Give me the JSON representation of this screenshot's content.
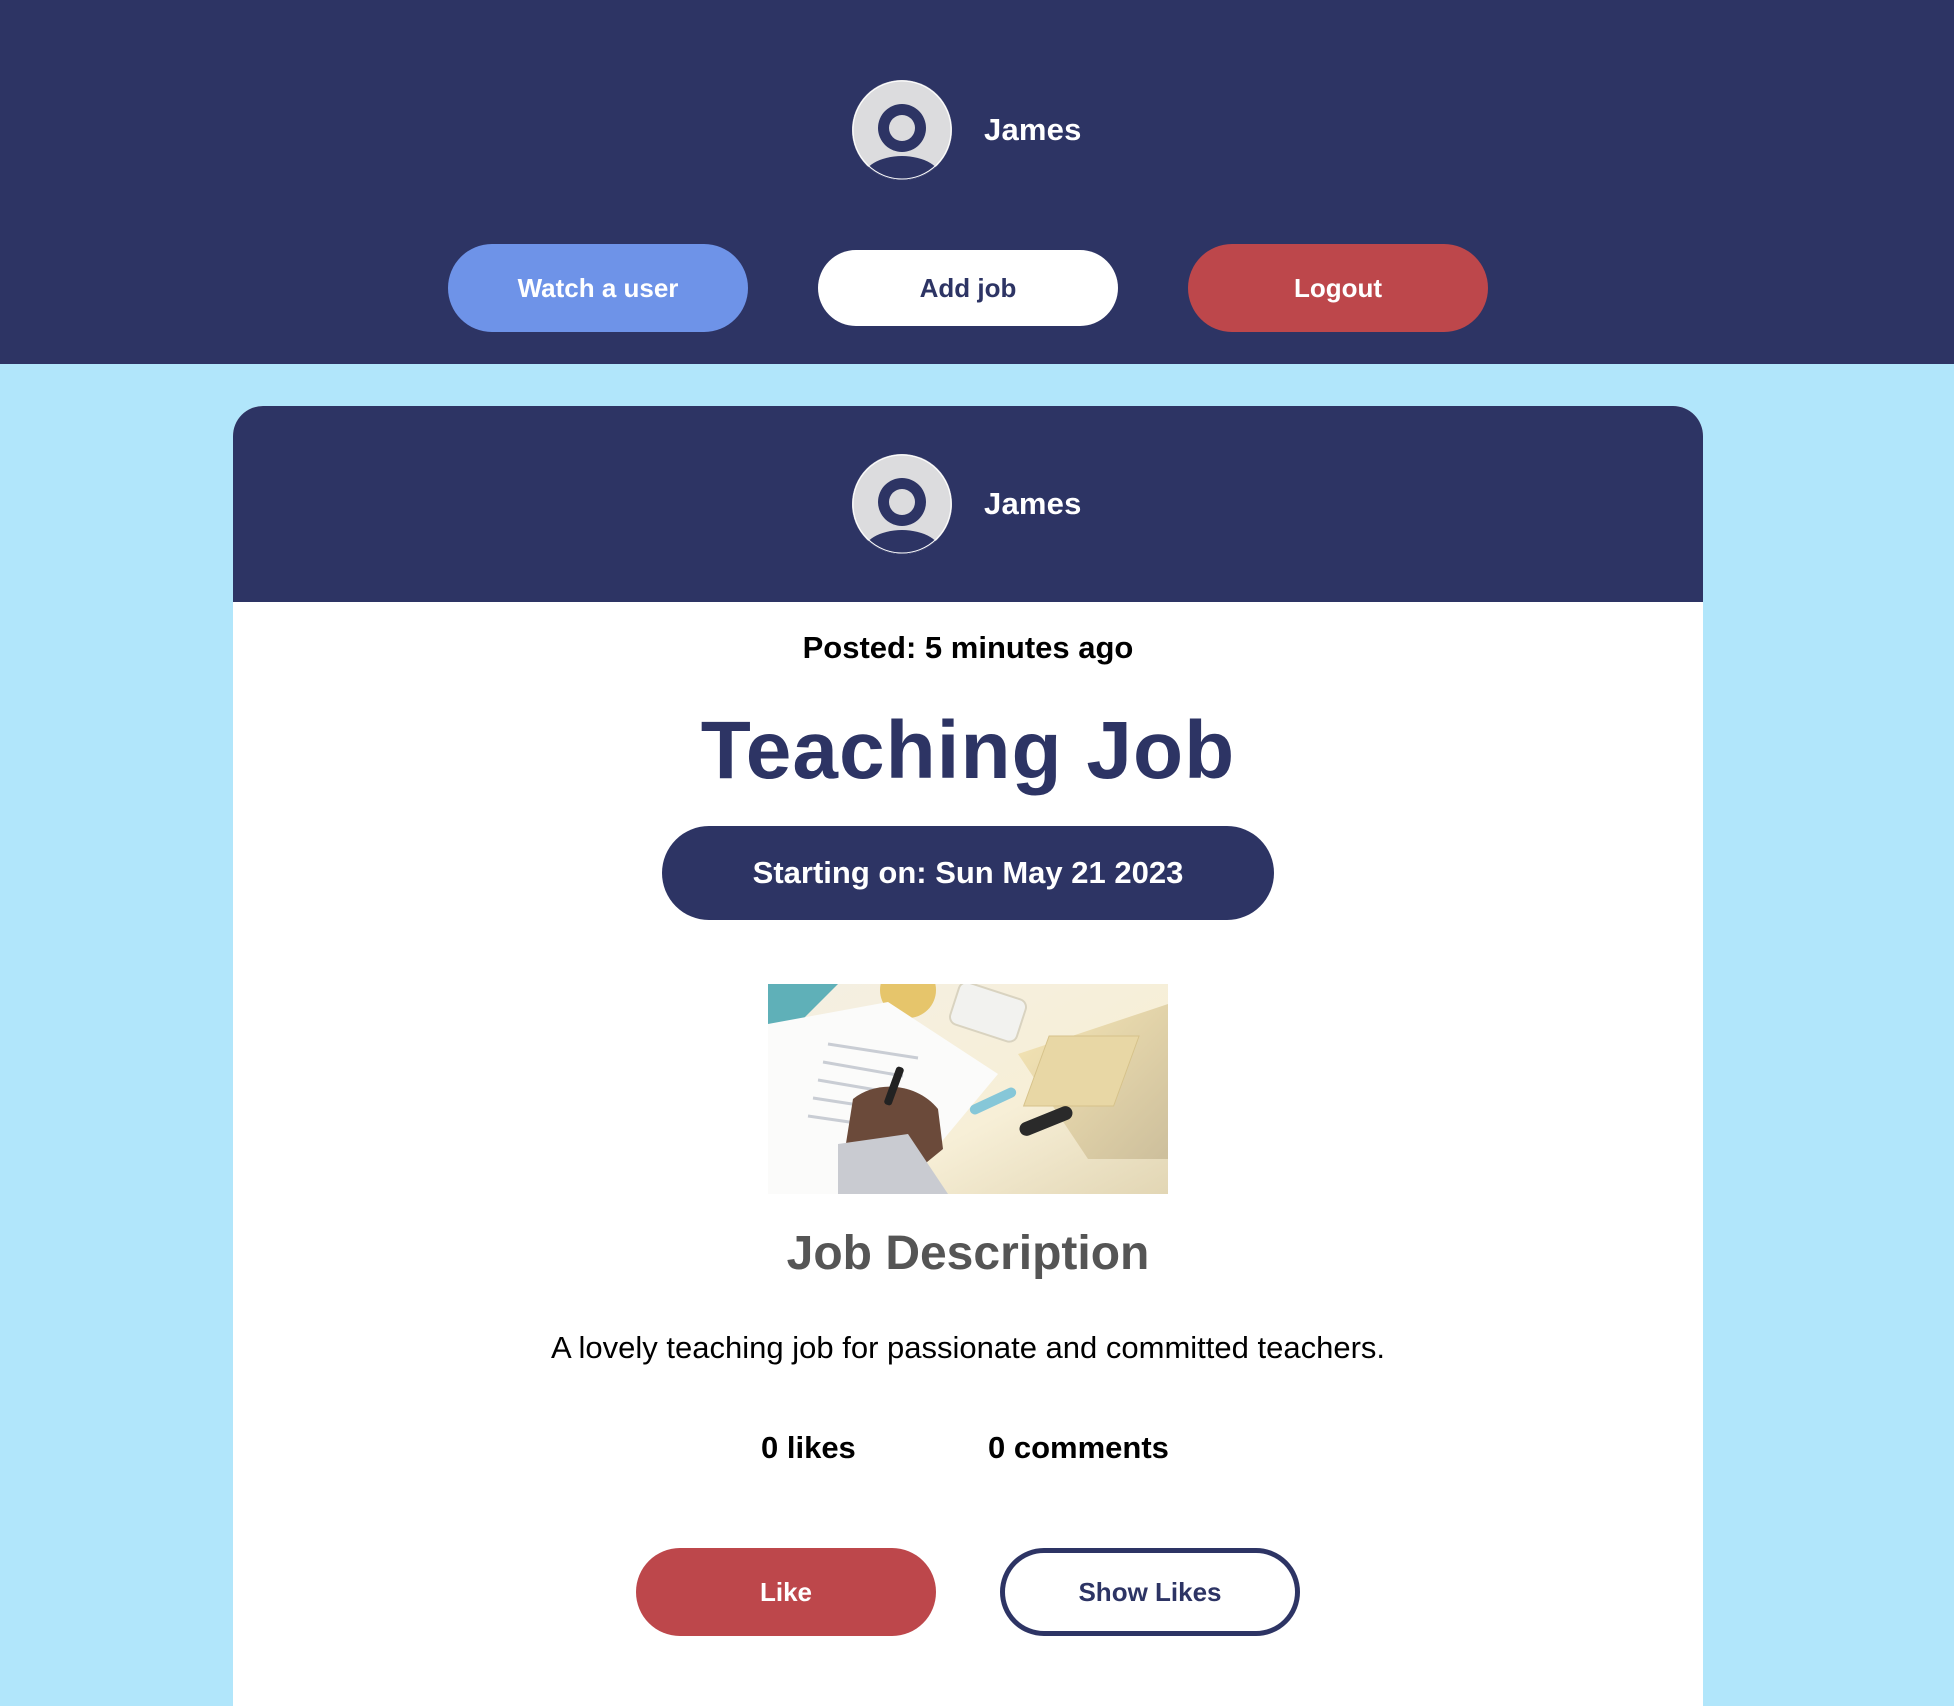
{
  "header": {
    "user": {
      "name": "James",
      "avatar_icon": "user-avatar-icon"
    },
    "buttons": {
      "watch_user": "Watch a user",
      "add_job": "Add job",
      "logout": "Logout"
    }
  },
  "post": {
    "author": {
      "name": "James",
      "avatar_icon": "user-avatar-icon"
    },
    "posted": "Posted: 5 minutes ago",
    "title": "Teaching Job",
    "start_date": "Starting on: Sun May 21 2023",
    "image_subject": "job-description-photo",
    "description_heading": "Job Description",
    "description": "A lovely teaching job for passionate and committed teachers.",
    "likes": "0 likes",
    "comments": "0 comments",
    "buttons": {
      "like": "Like",
      "show_likes": "Show Likes"
    }
  },
  "colors": {
    "navy": "#2d3464",
    "sky_background": "#b1e6fb",
    "watch_blue": "#6e93e8",
    "red": "#bd474b",
    "description_gray": "#555555"
  }
}
